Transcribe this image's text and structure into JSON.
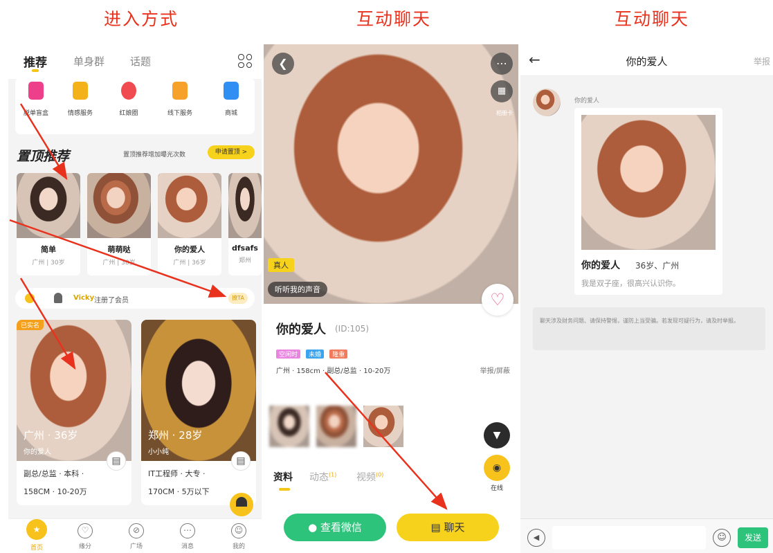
{
  "headings": [
    "进入方式",
    "互动聊天",
    "互动聊天"
  ],
  "colors": {
    "accent": "#f7c21c",
    "annotation": "#e8321e",
    "wechat_green": "#2ec37b"
  },
  "p1": {
    "tabs": [
      "推荐",
      "单身群",
      "话题"
    ],
    "menu": [
      {
        "label": "脱单盲盒",
        "icon": "gift-box-icon",
        "color": "#ee3f8a"
      },
      {
        "label": "情感服务",
        "icon": "counselor-icon",
        "color": "#f3b21a"
      },
      {
        "label": "红娘圈",
        "icon": "matchmaker-icon",
        "color": "#ef4b50"
      },
      {
        "label": "线下服务",
        "icon": "store-icon",
        "color": "#f5a12a"
      },
      {
        "label": "商城",
        "icon": "shop-bag-icon",
        "color": "#2f8ff3"
      }
    ],
    "section_title": "置顶推荐",
    "section_note": "置顶推荐增加曝光次数",
    "section_btn": "申请置顶 >",
    "cards": [
      {
        "name": "简单",
        "sub": "广州 | 30岁"
      },
      {
        "name": "萌萌哒",
        "sub": "广州 | 38岁"
      },
      {
        "name": "你的爱人",
        "sub": "广州 | 36岁"
      },
      {
        "name": "dfsafs",
        "sub": "郑州"
      }
    ],
    "notice": {
      "nick": "Vicky",
      "text": "注册了会员",
      "pill": "撩TA"
    },
    "big_cards": [
      {
        "tag": "已实名",
        "loc": "广州 · 36岁",
        "nick": "你的爱人",
        "line1": "副总/总监 · 本科 ·",
        "line2": "158CM · 10-20万"
      },
      {
        "tag": "",
        "loc": "郑州 · 28岁",
        "nick": "小小纯",
        "line1": "IT工程师 · 大专 ·",
        "line2": "170CM · 5万以下"
      }
    ],
    "service_label": "客服",
    "nav": [
      "首页",
      "缘分",
      "广场",
      "消息",
      "我的"
    ]
  },
  "p2": {
    "dots_label": "相册卡",
    "real_label": "真人",
    "voice_label": "听听我的声音",
    "name": "你的爱人",
    "id": "(ID:105)",
    "badges": [
      "空闲时",
      "未婚",
      "隆重"
    ],
    "info": "广州 · 158cm · 副总/总监 · 10-20万",
    "report": "举报/屏蔽",
    "online_label": "在线",
    "tabs": [
      {
        "label": "资料",
        "count": ""
      },
      {
        "label": "动态",
        "count": "(1)"
      },
      {
        "label": "视频",
        "count": "(0)"
      }
    ],
    "wechat_btn": "查看微信",
    "chat_btn": "聊天"
  },
  "p3": {
    "title": "你的爱人",
    "report": "举报",
    "sender": "你的爱人",
    "card_name": "你的爱人",
    "card_meta": "36岁、广州",
    "card_bio": "我是双子座，很高兴认识你。",
    "notice": "聊天涉及财务问题、请保持警惕，谨防上当受骗。若发现可疑行为，请及时举报。",
    "send": "发送"
  }
}
